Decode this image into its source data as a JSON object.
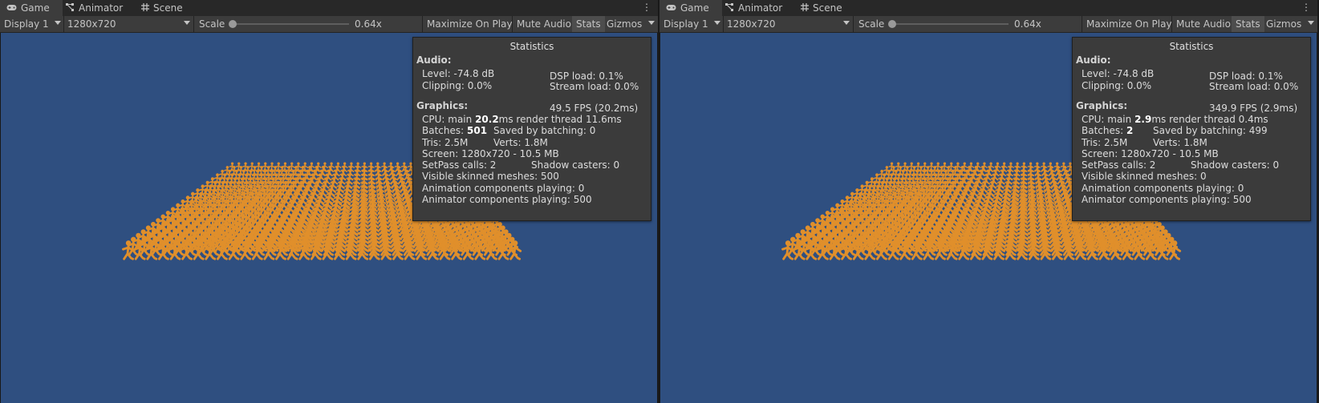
{
  "tabs": [
    {
      "label": "Game",
      "icon": "gamepad-icon",
      "active": true
    },
    {
      "label": "Animator",
      "icon": "animator-icon",
      "active": false
    },
    {
      "label": "Scene",
      "icon": "scene-grid-icon",
      "active": false
    }
  ],
  "toolbar": {
    "display": "Display 1",
    "resolution": "1280x720",
    "scale_label": "Scale",
    "scale_value": "0.64x",
    "maximize": "Maximize On Play",
    "mute": "Mute Audio",
    "stats": "Stats",
    "gizmos": "Gizmos"
  },
  "colors": {
    "viewport": "#2f4f80",
    "characters": "#e08f2b",
    "overlay": "#3b3b3b"
  },
  "views": [
    {
      "title": "Statistics",
      "audio_header": "Audio:",
      "level": "Level: -74.8 dB",
      "clipping": "Clipping: 0.0%",
      "dsp": "DSP load: 0.1%",
      "stream": "Stream load: 0.0%",
      "graphics_header": "Graphics:",
      "fps": "49.5 FPS (20.2ms)",
      "cpu_pre": "CPU: main ",
      "cpu_main": "20.2",
      "cpu_post": "ms  render thread 11.6ms",
      "batches_pre": "Batches: ",
      "batches_val": "501",
      "saved": "Saved by batching: 0",
      "tris": "Tris: 2.5M",
      "verts": "Verts: 1.8M",
      "screen": "Screen: 1280x720 - 10.5 MB",
      "setpass": "SetPass calls: 2",
      "shadow": "Shadow casters: 0",
      "skinned": "Visible skinned meshes: 500",
      "animation": "Animation components playing: 0",
      "animator": "Animator components playing: 500"
    },
    {
      "title": "Statistics",
      "audio_header": "Audio:",
      "level": "Level: -74.8 dB",
      "clipping": "Clipping: 0.0%",
      "dsp": "DSP load: 0.1%",
      "stream": "Stream load: 0.0%",
      "graphics_header": "Graphics:",
      "fps": "349.9 FPS (2.9ms)",
      "cpu_pre": "CPU: main ",
      "cpu_main": "2.9",
      "cpu_post": "ms  render thread 0.4ms",
      "batches_pre": "Batches: ",
      "batches_val": "2",
      "saved": "Saved by batching: 499",
      "tris": "Tris: 2.5M",
      "verts": "Verts: 1.8M",
      "screen": "Screen: 1280x720 - 10.5 MB",
      "setpass": "SetPass calls: 2",
      "shadow": "Shadow casters: 0",
      "skinned": "Visible skinned meshes: 0",
      "animation": "Animation components playing: 0",
      "animator": "Animator components playing: 500"
    }
  ]
}
